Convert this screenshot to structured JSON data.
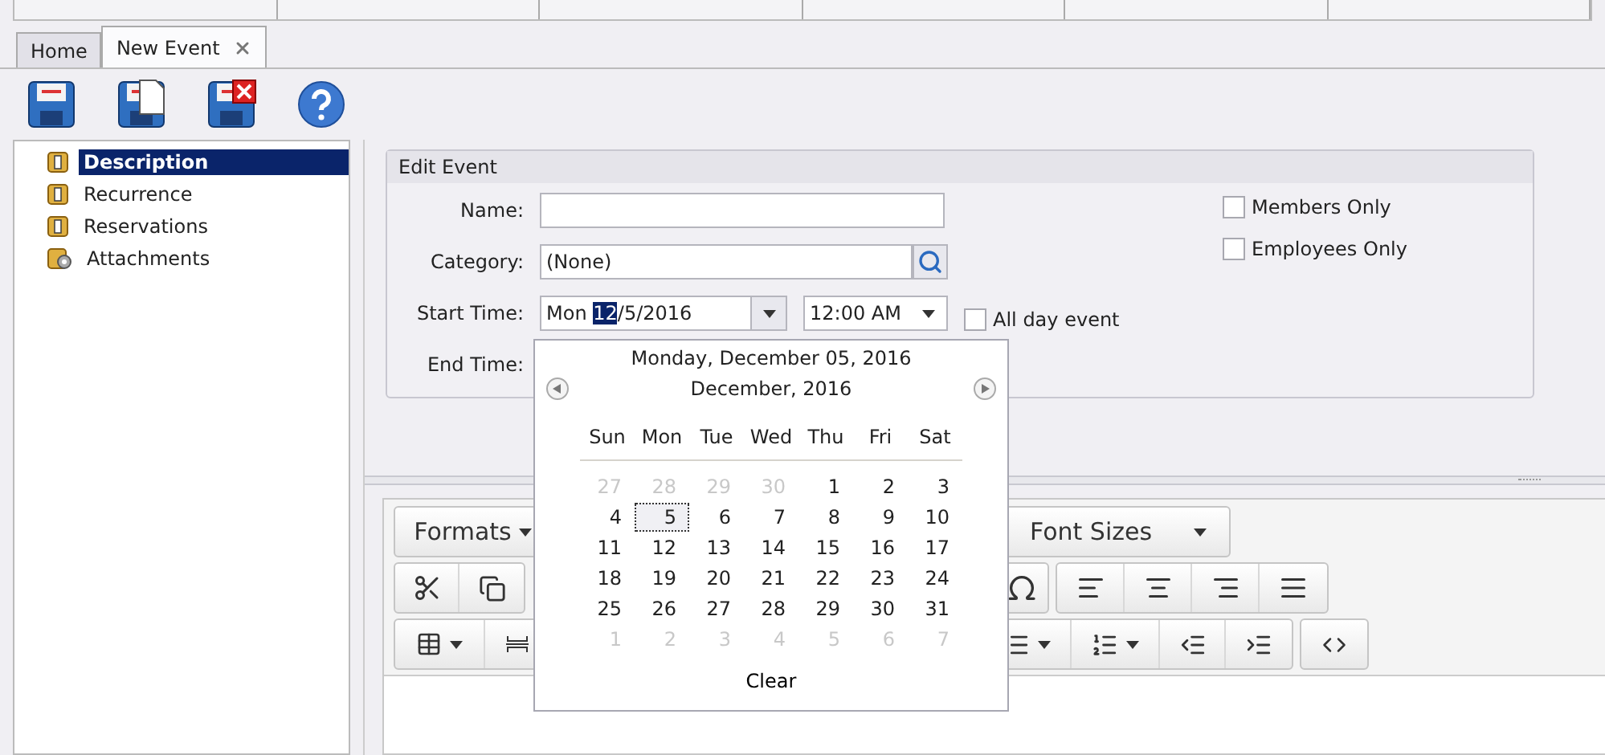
{
  "tabs": [
    {
      "label": "Home",
      "selected": false,
      "closable": false
    },
    {
      "label": "New Event",
      "selected": true,
      "closable": true
    }
  ],
  "toolbar": [
    {
      "kind": "save"
    },
    {
      "kind": "save_new"
    },
    {
      "kind": "save_close"
    },
    {
      "kind": "help"
    }
  ],
  "tree": [
    {
      "label": "Description",
      "kind": "folder",
      "selected": true
    },
    {
      "label": "Recurrence",
      "kind": "folder",
      "selected": false
    },
    {
      "label": "Reservations",
      "kind": "folder",
      "selected": false
    },
    {
      "label": "Attachments",
      "kind": "attachment",
      "selected": false
    }
  ],
  "edit_event": {
    "title": "Edit Event",
    "name": {
      "label": "Name:"
    },
    "category": {
      "label": "Category:",
      "value": "(None)"
    },
    "start_time": {
      "label": "Start Time:",
      "date_parts": [
        {
          "text": "Mon ",
          "selected": false
        },
        {
          "text": "12",
          "selected": true
        },
        {
          "text": "/5/2016",
          "selected": false
        }
      ],
      "time": "12:00 AM"
    },
    "all_day": {
      "label": "All day event",
      "checked": false
    },
    "end_time": {
      "label": "End Time:"
    },
    "options": [
      {
        "label": "Members Only",
        "checked": false
      },
      {
        "label": "Employees Only",
        "checked": false
      }
    ]
  },
  "calendar": {
    "date_title": "Monday, December 05, 2016",
    "month": "December, 2016",
    "weekdays": [
      "Sun",
      "Mon",
      "Tue",
      "Wed",
      "Thu",
      "Fri",
      "Sat"
    ],
    "weeks": [
      [
        {
          "day": "27",
          "other_month": true,
          "selected": false
        },
        {
          "day": "28",
          "other_month": true,
          "selected": false
        },
        {
          "day": "29",
          "other_month": true,
          "selected": false
        },
        {
          "day": "30",
          "other_month": true,
          "selected": false
        },
        {
          "day": "1",
          "other_month": false,
          "selected": false
        },
        {
          "day": "2",
          "other_month": false,
          "selected": false
        },
        {
          "day": "3",
          "other_month": false,
          "selected": false
        }
      ],
      [
        {
          "day": "4",
          "other_month": false,
          "selected": false
        },
        {
          "day": "5",
          "other_month": false,
          "selected": true
        },
        {
          "day": "6",
          "other_month": false,
          "selected": false
        },
        {
          "day": "7",
          "other_month": false,
          "selected": false
        },
        {
          "day": "8",
          "other_month": false,
          "selected": false
        },
        {
          "day": "9",
          "other_month": false,
          "selected": false
        },
        {
          "day": "10",
          "other_month": false,
          "selected": false
        }
      ],
      [
        {
          "day": "11",
          "other_month": false,
          "selected": false
        },
        {
          "day": "12",
          "other_month": false,
          "selected": false
        },
        {
          "day": "13",
          "other_month": false,
          "selected": false
        },
        {
          "day": "14",
          "other_month": false,
          "selected": false
        },
        {
          "day": "15",
          "other_month": false,
          "selected": false
        },
        {
          "day": "16",
          "other_month": false,
          "selected": false
        },
        {
          "day": "17",
          "other_month": false,
          "selected": false
        }
      ],
      [
        {
          "day": "18",
          "other_month": false,
          "selected": false
        },
        {
          "day": "19",
          "other_month": false,
          "selected": false
        },
        {
          "day": "20",
          "other_month": false,
          "selected": false
        },
        {
          "day": "21",
          "other_month": false,
          "selected": false
        },
        {
          "day": "22",
          "other_month": false,
          "selected": false
        },
        {
          "day": "23",
          "other_month": false,
          "selected": false
        },
        {
          "day": "24",
          "other_month": false,
          "selected": false
        }
      ],
      [
        {
          "day": "25",
          "other_month": false,
          "selected": false
        },
        {
          "day": "26",
          "other_month": false,
          "selected": false
        },
        {
          "day": "27",
          "other_month": false,
          "selected": false
        },
        {
          "day": "28",
          "other_month": false,
          "selected": false
        },
        {
          "day": "29",
          "other_month": false,
          "selected": false
        },
        {
          "day": "30",
          "other_month": false,
          "selected": false
        },
        {
          "day": "31",
          "other_month": false,
          "selected": false
        }
      ],
      [
        {
          "day": "1",
          "other_month": true,
          "selected": false
        },
        {
          "day": "2",
          "other_month": true,
          "selected": false
        },
        {
          "day": "3",
          "other_month": true,
          "selected": false
        },
        {
          "day": "4",
          "other_month": true,
          "selected": false
        },
        {
          "day": "5",
          "other_month": true,
          "selected": false
        },
        {
          "day": "6",
          "other_month": true,
          "selected": false
        },
        {
          "day": "7",
          "other_month": true,
          "selected": false
        }
      ]
    ],
    "clear": "Clear"
  },
  "editor": {
    "formats": "Formats",
    "font_sizes": "Font Sizes"
  }
}
